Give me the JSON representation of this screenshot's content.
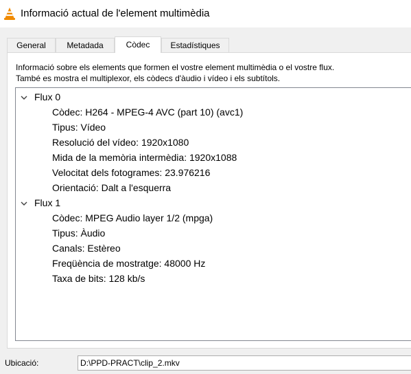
{
  "window": {
    "title": "Informació actual de l'element multimèdia",
    "icon": "vlc-cone-icon"
  },
  "tabs": [
    {
      "label": "General",
      "active": false
    },
    {
      "label": "Metadada",
      "active": false
    },
    {
      "label": "Còdec",
      "active": true
    },
    {
      "label": "Estadístiques",
      "active": false
    }
  ],
  "codec_panel": {
    "description_line1": "Informació sobre els elements que formen el vostre element multimèdia o el vostre flux.",
    "description_line2": "També es mostra el multiplexor, els còdecs d'àudio i vídeo i els subtítols.",
    "streams": [
      {
        "name": "Flux 0",
        "expanded": true,
        "properties": [
          "Còdec: H264 - MPEG-4 AVC (part 10) (avc1)",
          "Tipus: Vídeo",
          "Resolució del vídeo: 1920x1080",
          "Mida de la memòria intermèdia: 1920x1088",
          "Velocitat dels fotogrames: 23.976216",
          "Orientació: Dalt a l'esquerra"
        ]
      },
      {
        "name": "Flux 1",
        "expanded": true,
        "properties": [
          "Còdec: MPEG Audio layer 1/2 (mpga)",
          "Tipus: Àudio",
          "Canals: Estèreo",
          "Freqüència de mostratge: 48000 Hz",
          "Taxa de bits: 128 kb/s"
        ]
      }
    ]
  },
  "location": {
    "label": "Ubicació:",
    "value": "D:\\PPD-PRACT\\clip_2.mkv"
  },
  "colors": {
    "vlc_orange": "#f08a00",
    "border": "#828790",
    "tab_border": "#d9d9d9"
  }
}
